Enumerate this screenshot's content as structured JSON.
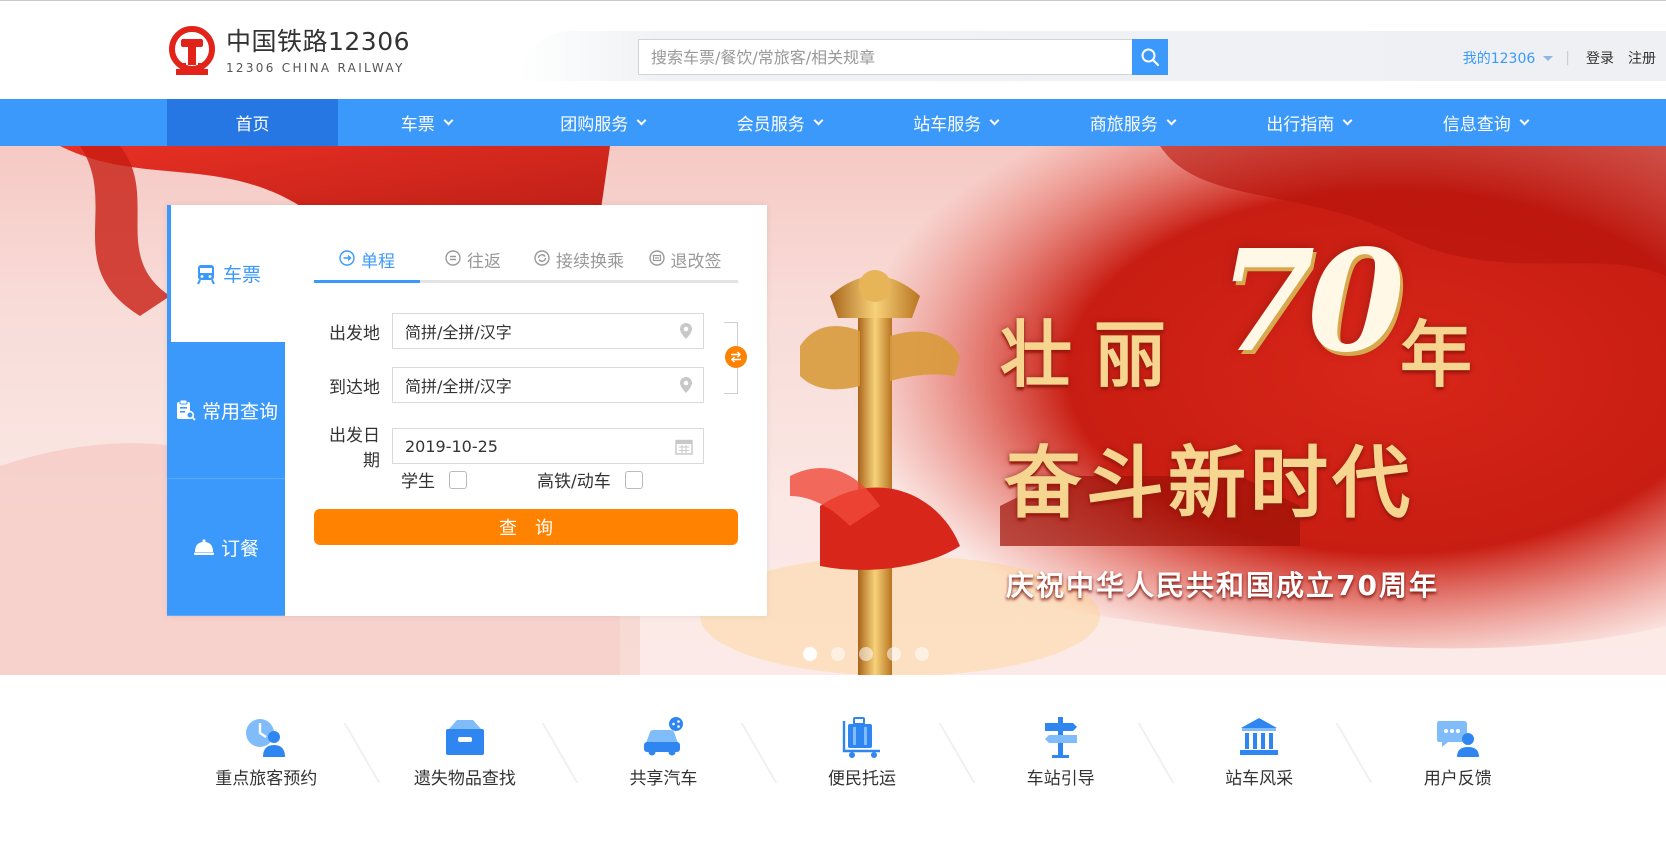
{
  "brand": {
    "title": "中国铁路12306",
    "subtitle": "12306 CHINA RAILWAY",
    "color": "#e2231a"
  },
  "search": {
    "placeholder": "搜索车票/餐饮/常旅客/相关规章",
    "button_icon": "search-icon"
  },
  "top_links": {
    "my_account": "我的12306",
    "login": "登录",
    "register": "注册"
  },
  "nav": {
    "items": [
      {
        "label": "首页",
        "active": true
      },
      {
        "label": "车票"
      },
      {
        "label": "团购服务"
      },
      {
        "label": "会员服务"
      },
      {
        "label": "站车服务"
      },
      {
        "label": "商旅服务"
      },
      {
        "label": "出行指南"
      },
      {
        "label": "信息查询"
      }
    ]
  },
  "sidebar": {
    "tabs": [
      {
        "label": "车票",
        "icon": "train-icon",
        "active": true
      },
      {
        "label": "常用查询",
        "icon": "clipboard-search-icon"
      },
      {
        "label": "订餐",
        "icon": "food-cover-icon"
      }
    ]
  },
  "booking": {
    "tabs": [
      {
        "label": "单程",
        "icon": "arrow-right-circle-icon",
        "active": true
      },
      {
        "label": "往返",
        "icon": "equals-circle-icon"
      },
      {
        "label": "接续换乘",
        "icon": "transfer-circle-icon"
      },
      {
        "label": "退改签",
        "icon": "ticket-circle-icon"
      }
    ],
    "from_label": "出发地",
    "from_placeholder": "简拼/全拼/汉字",
    "to_label": "到达地",
    "to_placeholder": "简拼/全拼/汉字",
    "date_label": "出发日期",
    "date_value": "2019-10-25",
    "student_label": "学生",
    "highspeed_label": "高铁/动车",
    "query_label": "查询"
  },
  "banner": {
    "line1_a": "壮丽",
    "number": "70",
    "line1_b": "年",
    "line2": "奋斗新时代",
    "sub": "庆祝中华人民共和国成立70周年",
    "slides": 5,
    "active_slide": 1
  },
  "services": [
    {
      "label": "重点旅客预约",
      "icon": "priority-passenger-icon"
    },
    {
      "label": "遗失物品查找",
      "icon": "lost-found-box-icon"
    },
    {
      "label": "共享汽车",
      "icon": "shared-car-icon"
    },
    {
      "label": "便民托运",
      "icon": "luggage-cart-icon"
    },
    {
      "label": "车站引导",
      "icon": "signpost-icon"
    },
    {
      "label": "站车风采",
      "icon": "station-building-icon"
    },
    {
      "label": "用户反馈",
      "icon": "user-feedback-icon"
    }
  ],
  "colors": {
    "primary": "#3b99fc",
    "primary_dark": "#2676e3",
    "accent": "#ff8200"
  }
}
